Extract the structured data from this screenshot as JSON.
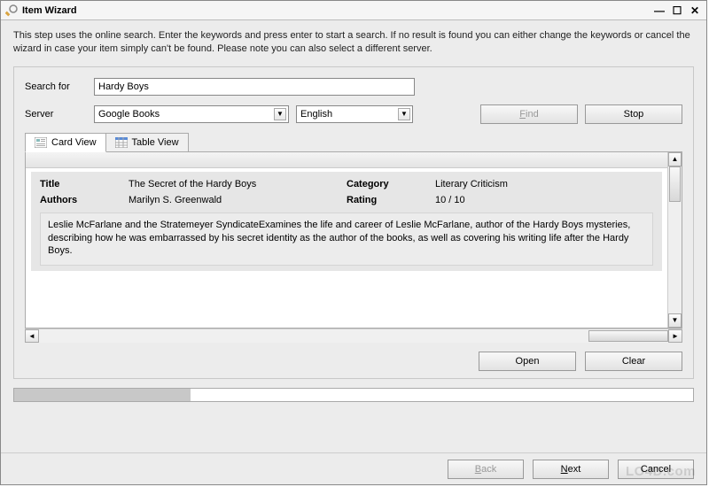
{
  "window": {
    "title": "Item Wizard",
    "description": "This step uses the online search. Enter the keywords and press enter to start a search. If no result is found you can either change the keywords or cancel the wizard in case your item simply can't be found. Please note you can also select a different server."
  },
  "form": {
    "search_label": "Search for",
    "search_value": "Hardy Boys",
    "server_label": "Server",
    "server_value": "Google Books",
    "language_value": "English",
    "find_label": "Find",
    "stop_label": "Stop"
  },
  "tabs": {
    "card_view": "Card View",
    "table_view": "Table View"
  },
  "result": {
    "title_label": "Title",
    "title_value": "The Secret of the Hardy Boys",
    "category_label": "Category",
    "category_value": "Literary Criticism",
    "authors_label": "Authors",
    "authors_value": "Marilyn S. Greenwald",
    "rating_label": "Rating",
    "rating_value": "10 / 10",
    "description": "Leslie McFarlane and the Stratemeyer SyndicateExamines the life and career of Leslie McFarlane, author of the Hardy Boys mysteries, describing how he was embarrassed by his secret identity as the author of the books, as well as covering his writing life after the Hardy Boys."
  },
  "actions": {
    "open_label": "Open",
    "clear_label": "Clear"
  },
  "footer": {
    "back_label": "Back",
    "next_label": "Next",
    "cancel_label": "Cancel"
  },
  "watermark": "LO4D.com"
}
